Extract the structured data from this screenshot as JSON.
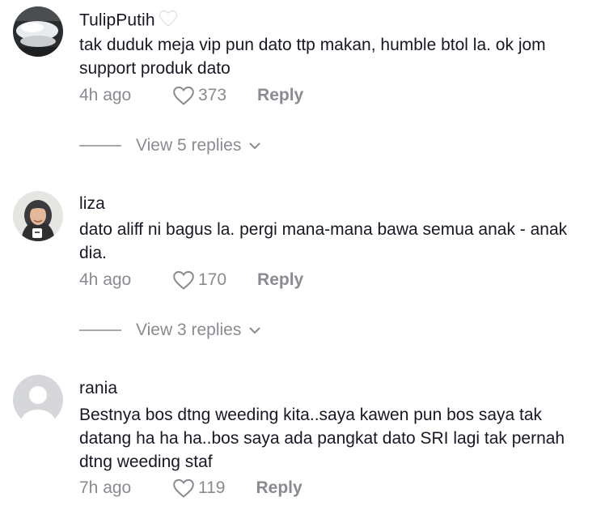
{
  "comments": [
    {
      "username": "TulipPutih",
      "badge_icon": "white-heart-icon",
      "text": "tak duduk meja vip pun dato ttp makan, humble btol la. ok jom support produk dato",
      "time": "4h ago",
      "likes": "373",
      "reply_label": "Reply",
      "view_replies": "View 5 replies"
    },
    {
      "username": "liza",
      "text": "dato aliff ni bagus la. pergi mana-mana bawa semua anak - anak dia.",
      "time": "4h ago",
      "likes": "170",
      "reply_label": "Reply",
      "view_replies": "View 3 replies"
    },
    {
      "username": "rania",
      "text": "Bestnya bos dtng weeding kita..saya kawen pun bos saya tak datang ha ha ha..bos saya ada pangkat dato SRI lagi tak pernah dtng weeding staf",
      "time": "7h ago",
      "likes": "119",
      "reply_label": "Reply"
    }
  ],
  "colors": {
    "text": "#161823",
    "muted": "#8a8b91",
    "default_avatar": "#d6d7db"
  }
}
